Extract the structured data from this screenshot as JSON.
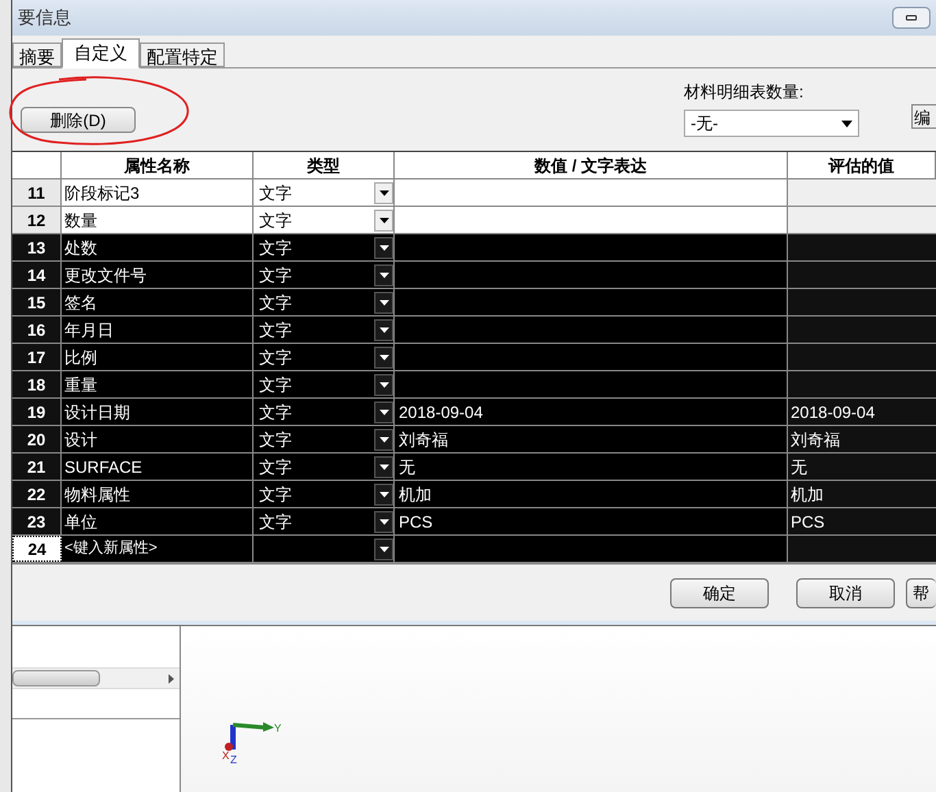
{
  "window": {
    "title": "要信息"
  },
  "tabs": [
    {
      "label": "摘要",
      "selected": false
    },
    {
      "label": "自定义",
      "selected": true
    },
    {
      "label": "配置特定",
      "selected": false
    }
  ],
  "delete_button": "删除(D)",
  "bom_quantity": {
    "label": "材料明细表数量:",
    "value": "-无-"
  },
  "edit_button": "编",
  "table": {
    "columns": [
      "属性名称",
      "类型",
      "数值 / 文字表达",
      "评估的值"
    ],
    "rows": [
      {
        "number": "11",
        "name": "阶段标记3",
        "type": "文字",
        "value": "",
        "evaluated": "",
        "selected": false,
        "kind": "property"
      },
      {
        "number": "12",
        "name": "数量",
        "type": "文字",
        "value": "",
        "evaluated": "",
        "selected": false,
        "kind": "property"
      },
      {
        "number": "13",
        "name": "处数",
        "type": "文字",
        "value": "",
        "evaluated": "",
        "selected": true,
        "kind": "property"
      },
      {
        "number": "14",
        "name": "更改文件号",
        "type": "文字",
        "value": "",
        "evaluated": "",
        "selected": true,
        "kind": "property"
      },
      {
        "number": "15",
        "name": "签名",
        "type": "文字",
        "value": "",
        "evaluated": "",
        "selected": true,
        "kind": "property"
      },
      {
        "number": "16",
        "name": "年月日",
        "type": "文字",
        "value": "",
        "evaluated": "",
        "selected": true,
        "kind": "property"
      },
      {
        "number": "17",
        "name": "比例",
        "type": "文字",
        "value": "",
        "evaluated": "",
        "selected": true,
        "kind": "property"
      },
      {
        "number": "18",
        "name": "重量",
        "type": "文字",
        "value": "",
        "evaluated": "",
        "selected": true,
        "kind": "property"
      },
      {
        "number": "19",
        "name": "设计日期",
        "type": "文字",
        "value": "2018-09-04",
        "evaluated": "2018-09-04",
        "selected": true,
        "kind": "property"
      },
      {
        "number": "20",
        "name": "设计",
        "type": "文字",
        "value": "刘奇福",
        "evaluated": "刘奇福",
        "selected": true,
        "kind": "property"
      },
      {
        "number": "21",
        "name": "SURFACE",
        "type": "文字",
        "value": "无",
        "evaluated": "无",
        "selected": true,
        "kind": "property"
      },
      {
        "number": "22",
        "name": "物料属性",
        "type": "文字",
        "value": "机加",
        "evaluated": "机加",
        "selected": true,
        "kind": "property"
      },
      {
        "number": "23",
        "name": "单位",
        "type": "文字",
        "value": "PCS",
        "evaluated": "PCS",
        "selected": true,
        "kind": "property"
      },
      {
        "number": "24",
        "name": "<键入新属性>",
        "type": "",
        "value": "",
        "evaluated": "",
        "selected": true,
        "kind": "new"
      }
    ]
  },
  "buttons": [
    "确定",
    "取消",
    "帮"
  ],
  "viewport": {
    "axes": {
      "x": "X",
      "y": "Y",
      "z": "Z"
    }
  }
}
